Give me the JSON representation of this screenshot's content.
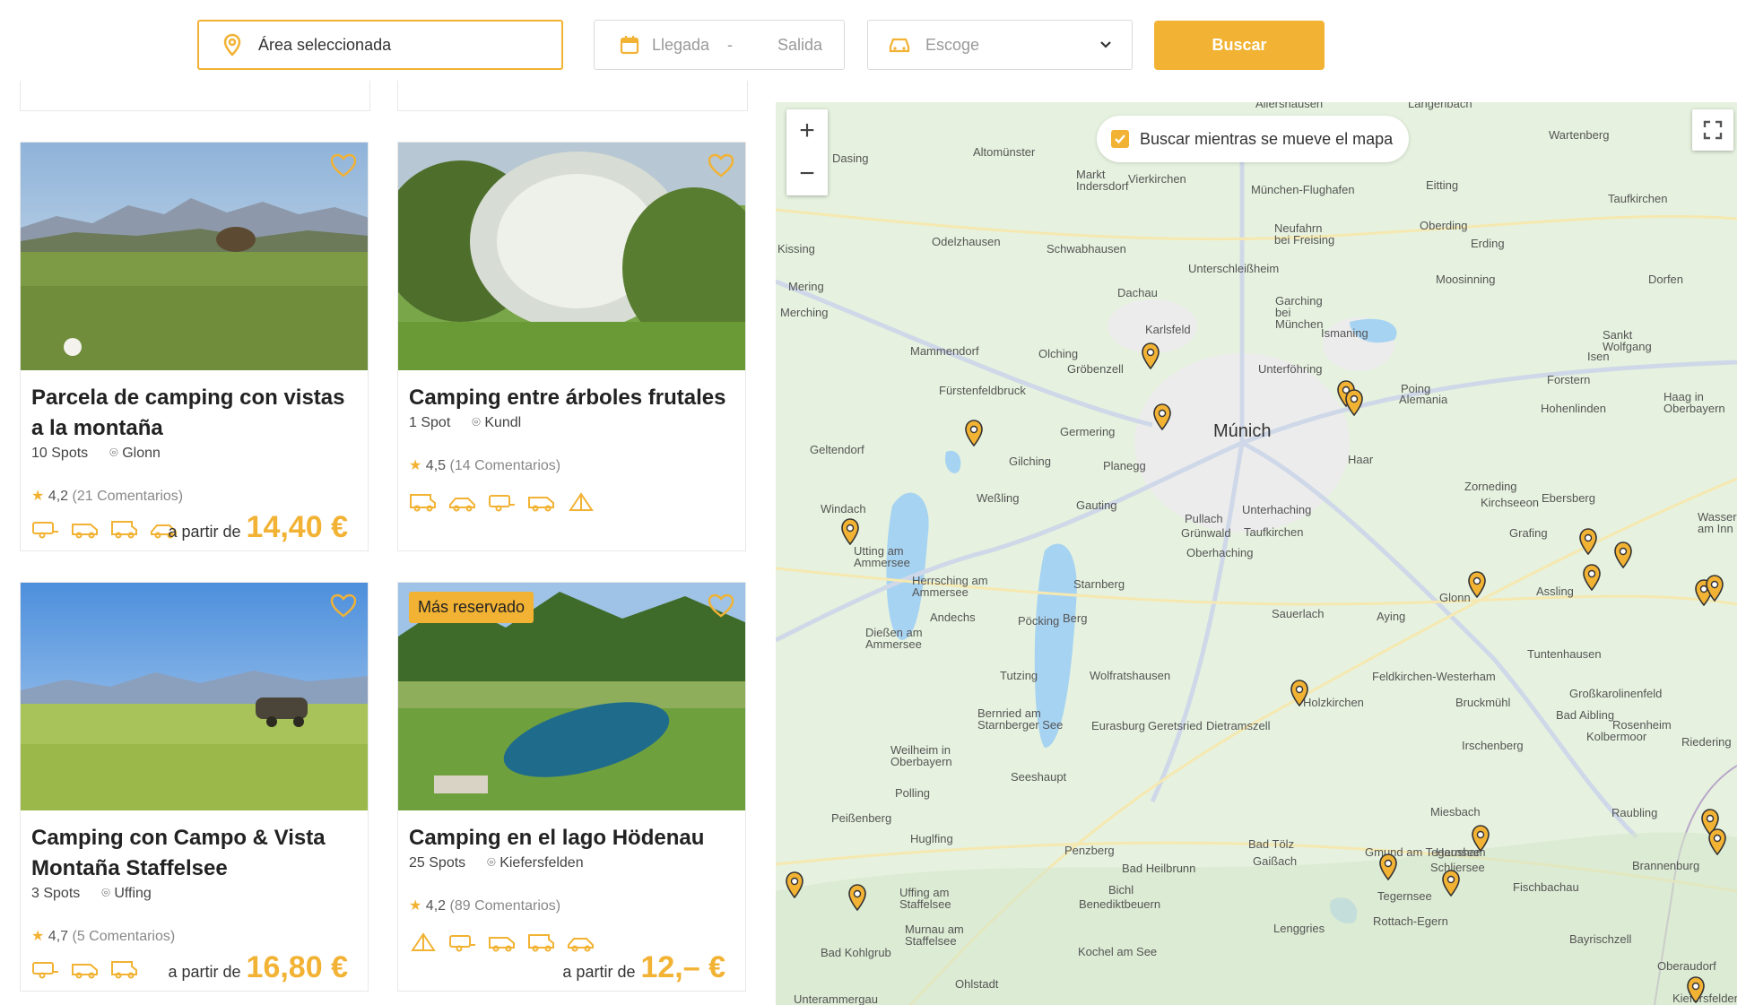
{
  "search": {
    "area_placeholder": "Área seleccionada",
    "arrival": "Llegada",
    "separator": "-",
    "departure": "Salida",
    "vehicle": "Escoge",
    "button": "Buscar"
  },
  "listings": [
    {
      "title": "Parcela de camping con vistas a la montaña",
      "spots": "10 Spots",
      "location": "Glonn",
      "rating": "4,2",
      "reviews": "(21 Comentarios)",
      "price_prefix": "a partir de",
      "price": "14,40 €",
      "vehicle_icons": [
        "caravan-icon",
        "van-icon",
        "motorhome-icon",
        "car-icon"
      ]
    },
    {
      "title": "Camping entre árboles frutales",
      "spots": "1 Spot",
      "location": "Kundl",
      "rating": "4,5",
      "reviews": "(14 Comentarios)",
      "vehicle_icons": [
        "motorhome-icon",
        "car-icon",
        "caravan-icon",
        "van-icon",
        "tent-icon"
      ]
    },
    {
      "title": "Camping con Campo & Vista Montaña Staffelsee",
      "spots": "3 Spots",
      "location": "Uffing",
      "rating": "4,7",
      "reviews": "(5 Comentarios)",
      "price_prefix": "a partir de",
      "price": "16,80 €",
      "vehicle_icons": [
        "caravan-icon",
        "van-icon",
        "motorhome-icon"
      ]
    },
    {
      "title": "Camping en el lago Hödenau",
      "badge": "Más reservado",
      "spots": "25 Spots",
      "location": "Kiefersfelden",
      "rating": "4,2",
      "reviews": "(89 Comentarios)",
      "price_prefix": "a partir de",
      "price": "12,– €",
      "vehicle_icons": [
        "tent-icon",
        "caravan-icon",
        "van-icon",
        "motorhome-icon",
        "car-icon"
      ]
    }
  ],
  "map": {
    "zoom_in": "+",
    "zoom_out": "−",
    "search_on_move": "Buscar mientras se mueve el mapa",
    "city": "Múnich",
    "places": [
      "Allershausen",
      "Langenbach",
      "Wartenberg",
      "Dasing",
      "Altomünster",
      "Markt Indersdorf",
      "Vierkirchen",
      "München-Flughafen",
      "Eitting",
      "Taufkirchen",
      "Oberding",
      "Erding",
      "Neufahrn bei Freising",
      "Odelzhausen",
      "Schwabhausen",
      "Unterschleißheim",
      "Moosinning",
      "Dorfen",
      "Kissing",
      "Mering",
      "Merching",
      "Dachau",
      "Garching bei München",
      "Ismaning",
      "Karlsfeld",
      "Sankt Wolfgang",
      "Mammendorf",
      "Olching",
      "Gröbenzell",
      "Unterföhring",
      "Isen",
      "Forstern",
      "Fürstenfeldbruck",
      "Poing",
      "Alemania",
      "Hohenlinden",
      "Haag in Oberbayern",
      "Germering",
      "Geltendorf",
      "Gilching",
      "Planegg",
      "Haar",
      "Zorneding",
      "Kirchseeon",
      "Ebersberg",
      "Weßling",
      "Gauting",
      "Unterhaching",
      "Windach",
      "Pullach",
      "Grünwald",
      "Taufkirchen",
      "Grafing",
      "Wasserburg am Inn",
      "Utting am Ammersee",
      "Oberhaching",
      "Herrsching am Ammersee",
      "Starnberg",
      "Assling",
      "Andechs",
      "Glonn",
      "Sauerlach",
      "Aying",
      "Dießen am Ammersee",
      "Pöcking",
      "Berg",
      "Tuntenhausen",
      "Tutzing",
      "Wolfratshausen",
      "Feldkirchen-Westerham",
      "Holzkirchen",
      "Bruckmühl",
      "Großkarolinenfeld",
      "Bernried am Starnberger See",
      "Eurasburg",
      "Geretsried",
      "Dietramszell",
      "Bad Aibling",
      "Rosenheim",
      "Kolbermoor",
      "Weilheim in Oberbayern",
      "Irschenberg",
      "Riedering",
      "Seeshaupt",
      "Polling",
      "Miesbach",
      "Raubling",
      "Peißenberg",
      "Huglfing",
      "Penzberg",
      "Bad Tölz",
      "Gmund am Tegernsee",
      "Hausham",
      "Brannenburg",
      "Bad Heilbrunn",
      "Gaißach",
      "Schliersee",
      "Uffing am Staffelsee",
      "Bichl",
      "Benediktbeuern",
      "Tegernsee",
      "Fischbachau",
      "Rottach-Egern",
      "Murnau am Staffelsee",
      "Lenggries",
      "Bayrischzell",
      "Bad Kohlgrub",
      "Kochel am See",
      "Oberaudorf",
      "Ohlstadt",
      "Unterammergau",
      "Kiefersfelden"
    ]
  }
}
